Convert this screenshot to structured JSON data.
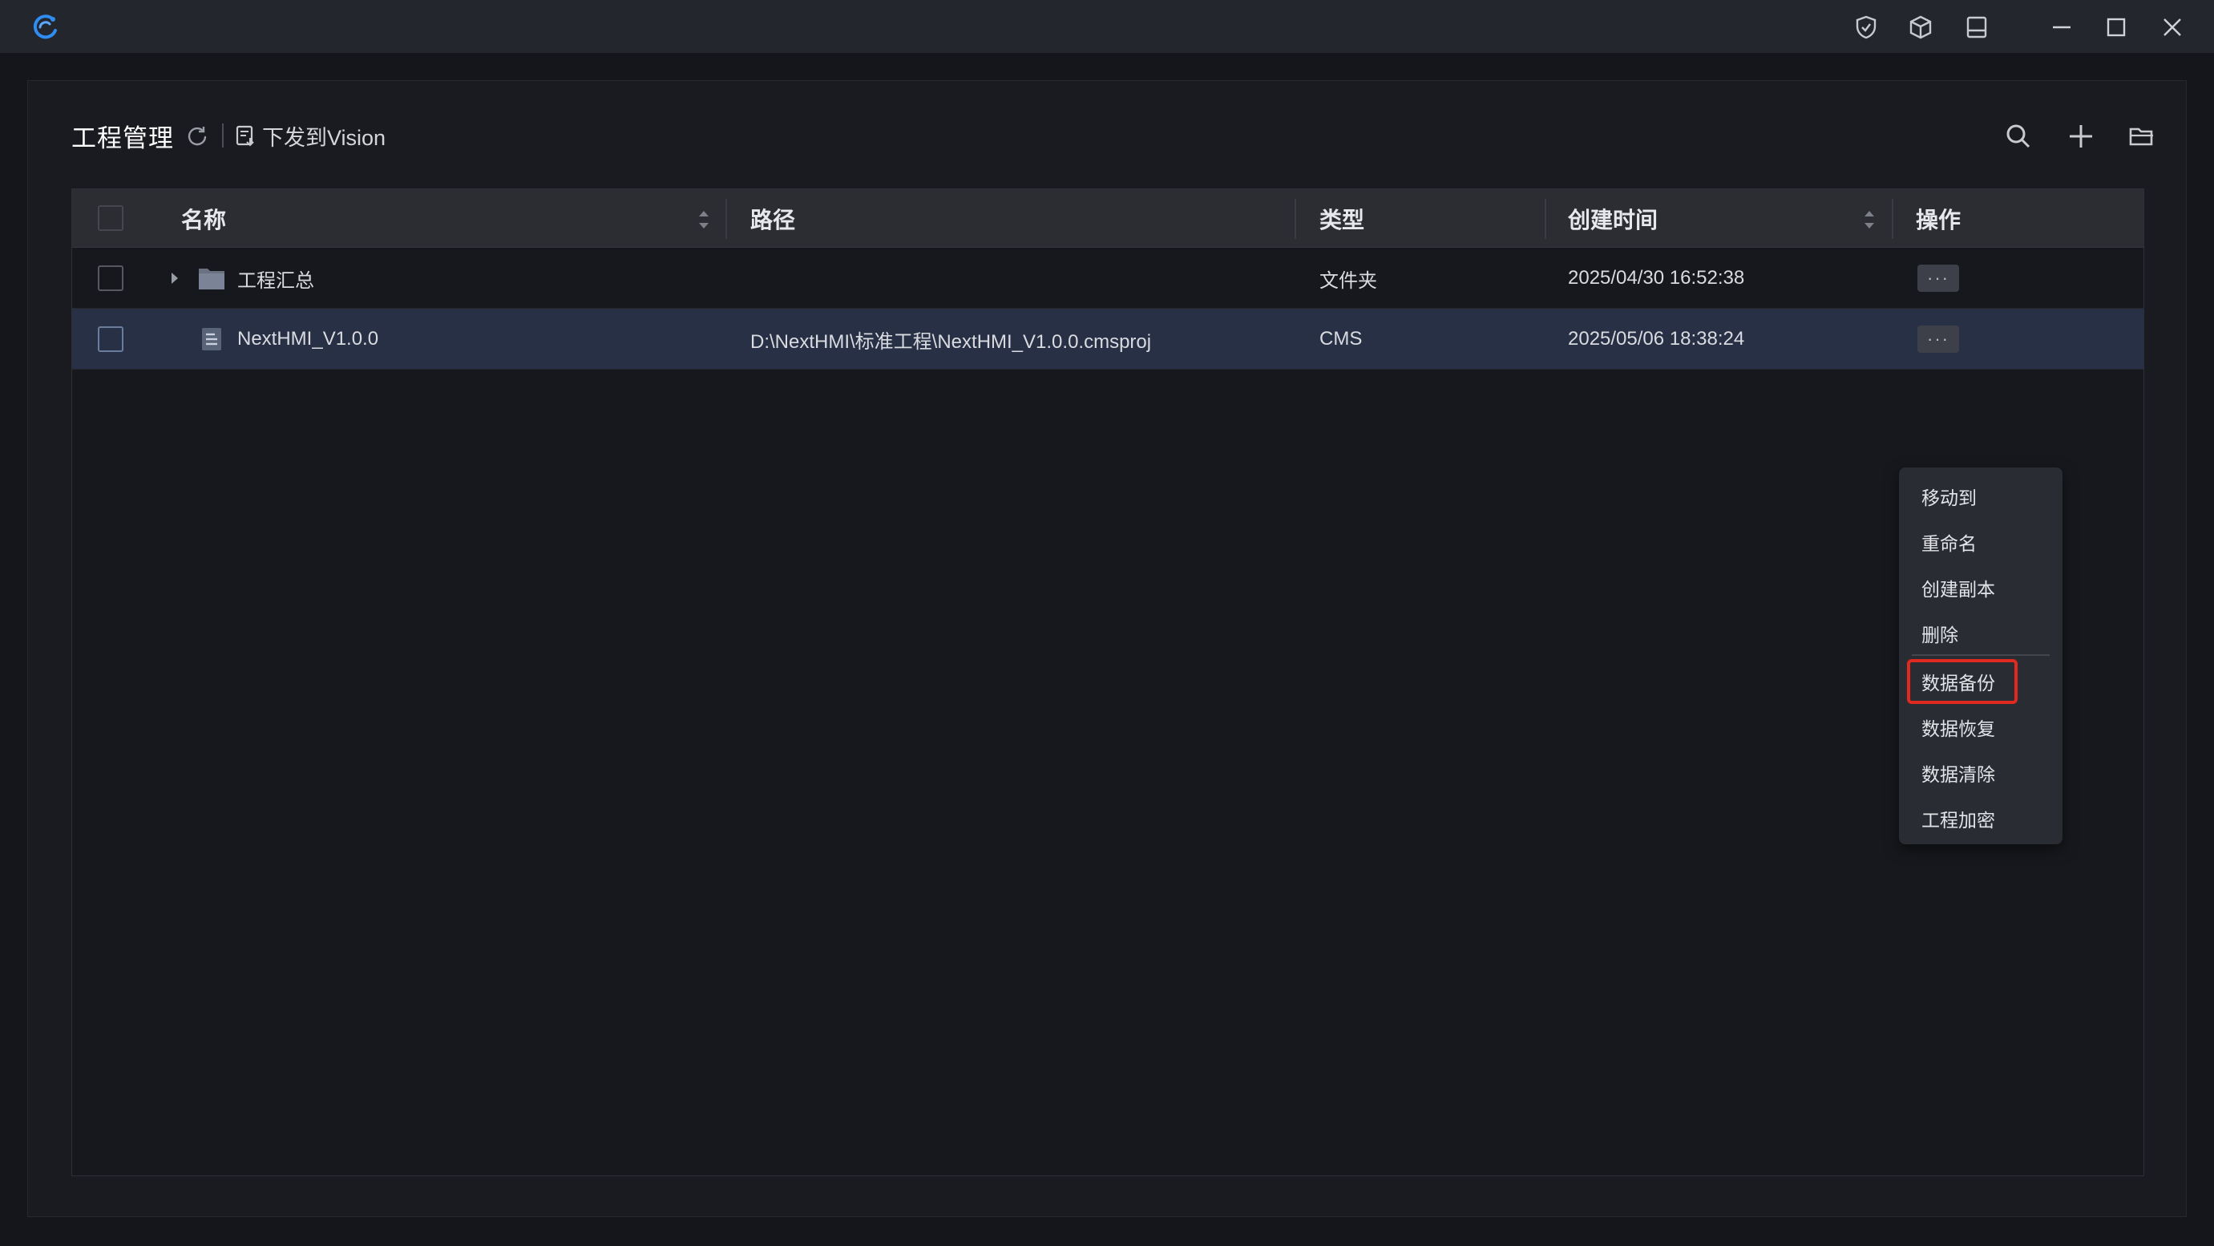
{
  "window": {
    "icons": [
      "app-logo-icon",
      "shield-check-icon",
      "cube-icon",
      "panel-layout-icon",
      "minimize-icon",
      "maximize-icon",
      "close-icon"
    ]
  },
  "header": {
    "title": "工程管理",
    "deploy_label": "下发到Vision"
  },
  "table": {
    "columns": {
      "name": "名称",
      "path": "路径",
      "type": "类型",
      "created": "创建时间",
      "actions": "操作"
    },
    "rows": [
      {
        "name": "工程汇总",
        "path": "",
        "type": "文件夹",
        "created": "2025/04/30 16:52:38",
        "icon": "folder-icon",
        "expandable": true
      },
      {
        "name": "NextHMI_V1.0.0",
        "path": "D:\\NextHMI\\标准工程\\NextHMI_V1.0.0.cmsproj",
        "type": "CMS",
        "created": "2025/05/06 18:38:24",
        "icon": "document-icon",
        "selected": true
      }
    ]
  },
  "context_menu": {
    "items": [
      "移动到",
      "重命名",
      "创建副本",
      "删除",
      "数据备份",
      "数据恢复",
      "数据清除",
      "工程加密"
    ],
    "highlighted": "数据备份"
  },
  "colors": {
    "accent": "#2f8cf0",
    "highlight_border": "#e02a20",
    "selected_row": "#283045"
  }
}
